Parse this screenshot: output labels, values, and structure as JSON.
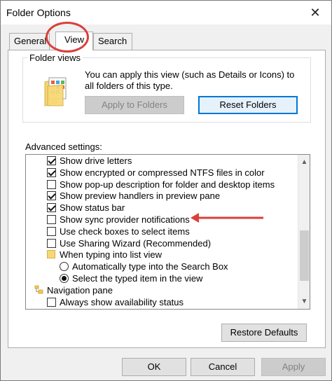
{
  "window": {
    "title": "Folder Options"
  },
  "tabs": [
    {
      "label": "General",
      "active": false
    },
    {
      "label": "View",
      "active": true
    },
    {
      "label": "Search",
      "active": false
    }
  ],
  "folder_views": {
    "group_label": "Folder views",
    "description": "You can apply this view (such as Details or Icons) to all folders of this type.",
    "apply_button": "Apply to Folders",
    "reset_button": "Reset Folders"
  },
  "advanced": {
    "label": "Advanced settings:",
    "items": [
      {
        "type": "checkbox",
        "checked": true,
        "label": "Show drive letters",
        "indent": 1
      },
      {
        "type": "checkbox",
        "checked": true,
        "label": "Show encrypted or compressed NTFS files in color",
        "indent": 1
      },
      {
        "type": "checkbox",
        "checked": false,
        "label": "Show pop-up description for folder and desktop items",
        "indent": 1
      },
      {
        "type": "checkbox",
        "checked": true,
        "label": "Show preview handlers in preview pane",
        "indent": 1
      },
      {
        "type": "checkbox",
        "checked": true,
        "label": "Show status bar",
        "indent": 1
      },
      {
        "type": "checkbox",
        "checked": false,
        "label": "Show sync provider notifications",
        "indent": 1
      },
      {
        "type": "checkbox",
        "checked": false,
        "label": "Use check boxes to select items",
        "indent": 1
      },
      {
        "type": "checkbox",
        "checked": false,
        "label": "Use Sharing Wizard (Recommended)",
        "indent": 1
      },
      {
        "type": "folder",
        "label": "When typing into list view",
        "indent": 1
      },
      {
        "type": "radio",
        "selected": false,
        "label": "Automatically type into the Search Box",
        "indent": 2
      },
      {
        "type": "radio",
        "selected": true,
        "label": "Select the typed item in the view",
        "indent": 2
      },
      {
        "type": "nav",
        "label": "Navigation pane",
        "indent": 0
      },
      {
        "type": "checkbox",
        "checked": false,
        "label": "Always show availability status",
        "indent": 1
      }
    ]
  },
  "buttons": {
    "restore_defaults": "Restore Defaults",
    "ok": "OK",
    "cancel": "Cancel",
    "apply": "Apply"
  },
  "annotation_color": "#d9403a",
  "accent_color": "#0078d7"
}
